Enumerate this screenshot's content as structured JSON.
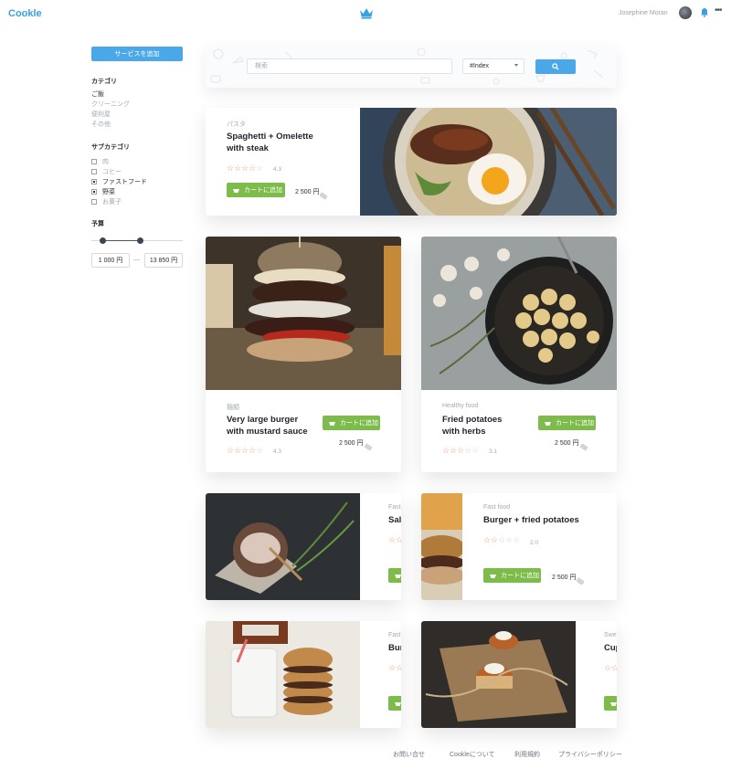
{
  "header": {
    "brand": "Cookle",
    "user_name": "Josephine Moran",
    "menu_dots": "•••"
  },
  "sidebar": {
    "add_service_label": "サービスを追加",
    "category_title": "カテゴリ",
    "categories": [
      {
        "label": "ご飯",
        "active": true
      },
      {
        "label": "クリーニング",
        "active": false
      },
      {
        "label": "便利屋",
        "active": false
      },
      {
        "label": "その他",
        "active": false
      }
    ],
    "subcategory_title": "サブカテゴリ",
    "subcategories": [
      {
        "label": "肉",
        "checked": false
      },
      {
        "label": "コヒー",
        "checked": false
      },
      {
        "label": "ファストフード",
        "checked": true
      },
      {
        "label": "野菜",
        "checked": true
      },
      {
        "label": "お菓子",
        "checked": false
      }
    ],
    "budget_title": "予算",
    "budget_min": "1 000 円",
    "budget_max": "13 850 円",
    "budget_dash": "—"
  },
  "search": {
    "placeholder": "検索",
    "select_value": "#Index"
  },
  "cards": [
    {
      "category": "パスタ",
      "title_line1": "Spaghetti + Omelette",
      "title_line2": "with steak",
      "rating": "4.3",
      "rating_stars": 4,
      "cart_label": "カートに追加",
      "price": "2 500 円"
    },
    {
      "category": "麺類",
      "title_line1": "Very large burger",
      "title_line2": "with mustard sauce",
      "rating": "4.3",
      "rating_stars": 4,
      "cart_label": "カートに追加",
      "price": "2 500 円"
    },
    {
      "category": "Healthy food",
      "title_line1": "Fried potatoes",
      "title_line2": "with herbs",
      "rating": "3.1",
      "rating_stars": 3,
      "cart_label": "カートに追加",
      "price": "2 500 円"
    },
    {
      "category": "Fast",
      "title_line1": "Sal",
      "rating_stars": 2
    },
    {
      "category": "Fast food",
      "title_line1": "Burger + fried potatoes",
      "rating": "2.0",
      "rating_stars": 2,
      "cart_label": "カートに追加",
      "price": "2 500 円"
    },
    {
      "category": "Fast",
      "title_line1": "Bur",
      "rating_stars": 2
    },
    {
      "category": "Swe",
      "title_line1": "Cup",
      "rating_stars": 2
    }
  ],
  "footer": {
    "links": [
      "お問い合せ",
      "Cookleについて",
      "利用規約",
      "プライバシーポリシー"
    ]
  },
  "colors": {
    "accent": "#4aa8e8",
    "cart_green": "#7dbb4a",
    "star": "#f39a7a",
    "brand": "#3aa0e0"
  },
  "icons": [
    "crown-icon",
    "bell-icon",
    "search-icon",
    "cart-icon",
    "price-tag-icon",
    "star-icon"
  ]
}
